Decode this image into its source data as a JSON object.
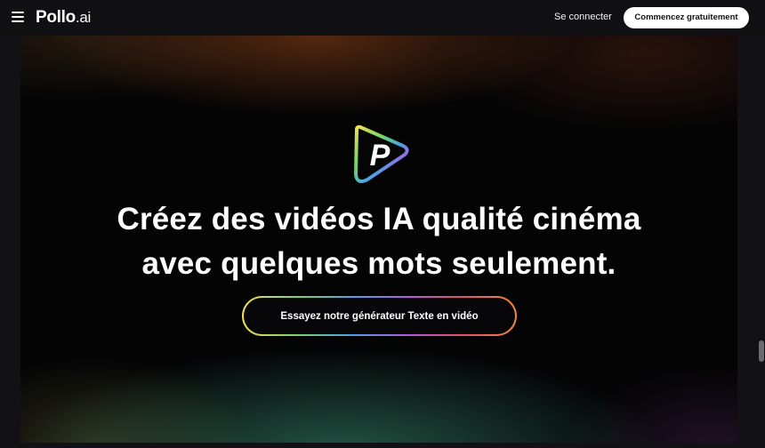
{
  "nav": {
    "logo_main": "Pollo",
    "logo_suffix": ".ai",
    "signin_label": "Se connecter",
    "cta_label": "Commencez gratuitement"
  },
  "hero": {
    "brand_letter": "P",
    "headline_line1": "Créez des vidéos IA qualité cinéma",
    "headline_line2": "avec quelques mots seulement.",
    "cta_label": "Essayez notre générateur Texte en vidéo"
  },
  "icons": {
    "menu": "hamburger-menu-icon",
    "brand": "pollo-play-logo-icon"
  },
  "colors": {
    "page_bg": "#111114",
    "hero_bg": "#040405",
    "top_cta_bg": "#ffffff",
    "gradient_yellow": "#f4e04d",
    "gradient_green": "#7ad36b",
    "gradient_blue": "#4aa3e8",
    "gradient_purple": "#b05be0",
    "gradient_red": "#e0506e",
    "gradient_orange": "#f08a3c"
  }
}
